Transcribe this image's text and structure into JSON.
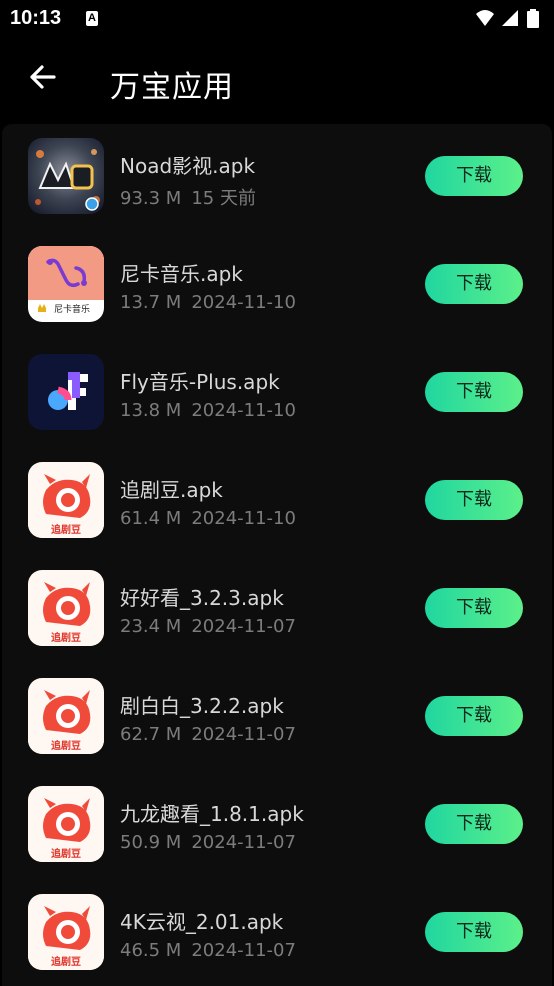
{
  "status_bar": {
    "time": "10:13",
    "notification_icon": "a-icon",
    "wifi_icon": "wifi-icon",
    "signal_icon": "signal-icon",
    "battery_icon": "battery-icon"
  },
  "app_bar": {
    "back_icon": "arrow-left-icon",
    "title": "万宝应用"
  },
  "colors": {
    "background": "#000000",
    "list_background": "#0d0d0d",
    "button_gradient_start": "#20d6a0",
    "button_gradient_end": "#5cf08a",
    "name_text": "#d8d8d8",
    "meta_text": "#7c7c7c"
  },
  "download_label": "下载",
  "apps": [
    {
      "name": "Noad影视.apk",
      "size": "93.3 M",
      "date": "15 天前",
      "icon": "noad-app-icon"
    },
    {
      "name": "尼卡音乐.apk",
      "size": "13.7 M",
      "date": "2024-11-10",
      "icon": "nika-music-app-icon",
      "icon_text": "尼卡音乐"
    },
    {
      "name": "Fly音乐-Plus.apk",
      "size": "13.8 M",
      "date": "2024-11-10",
      "icon": "fly-music-app-icon"
    },
    {
      "name": "追剧豆.apk",
      "size": "61.4 M",
      "date": "2024-11-10",
      "icon": "zhuijudou-app-icon",
      "icon_text": "追剧豆"
    },
    {
      "name": "好好看_3.2.3.apk",
      "size": "23.4 M",
      "date": "2024-11-07",
      "icon": "zhuijudou-app-icon",
      "icon_text": "追剧豆"
    },
    {
      "name": "剧白白_3.2.2.apk",
      "size": "62.7 M",
      "date": "2024-11-07",
      "icon": "zhuijudou-app-icon",
      "icon_text": "追剧豆"
    },
    {
      "name": "九龙趣看_1.8.1.apk",
      "size": "50.9 M",
      "date": "2024-11-07",
      "icon": "zhuijudou-app-icon",
      "icon_text": "追剧豆"
    },
    {
      "name": "4K云视_2.01.apk",
      "size": "46.5 M",
      "date": "2024-11-07",
      "icon": "zhuijudou-app-icon",
      "icon_text": "追剧豆"
    }
  ]
}
